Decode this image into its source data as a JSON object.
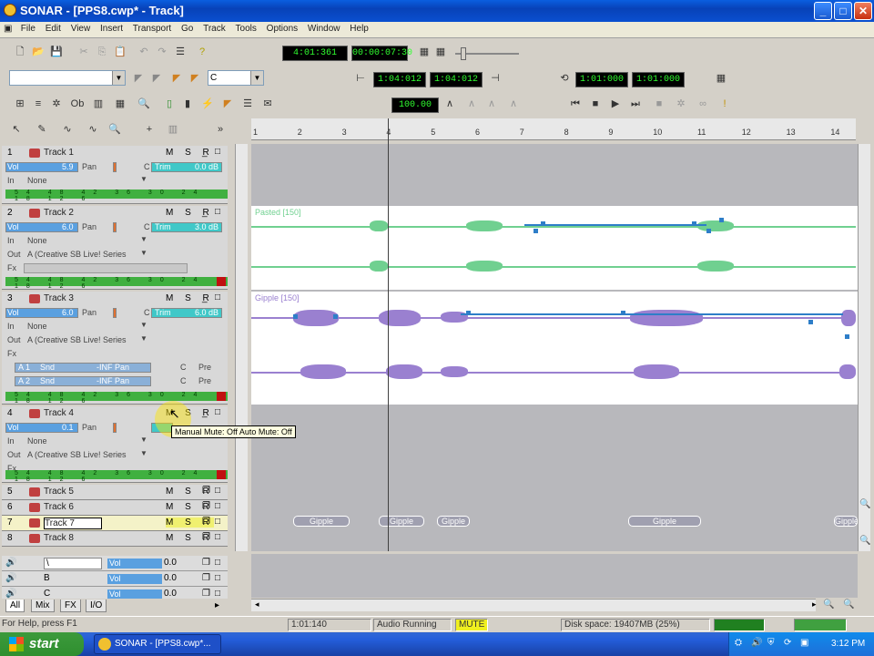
{
  "window": {
    "title": "SONAR - [PPS8.cwp* - Track]"
  },
  "menu": [
    "File",
    "Edit",
    "View",
    "Insert",
    "Transport",
    "Go",
    "Track",
    "Tools",
    "Options",
    "Window",
    "Help"
  ],
  "transport": {
    "now_time": "4:01:361",
    "smpte": "00:00:07:30",
    "loop_start": "1:04:012",
    "loop_end": "1:04:012",
    "punch_start": "1:01:000",
    "punch_end": "1:01:000",
    "tempo": "100.00",
    "key_combo": "C"
  },
  "ruler_ticks": [
    "1",
    "2",
    "3",
    "4",
    "5",
    "6",
    "7",
    "8",
    "9",
    "10",
    "11",
    "12",
    "13",
    "14"
  ],
  "tracks": [
    {
      "num": "1",
      "name": "Track 1",
      "vol_label": "Vol",
      "vol": "5.9",
      "pan_label": "Pan",
      "pan": "C",
      "trim_label": "Trim",
      "trim": "0.0 dB",
      "in_label": "In",
      "input": "None",
      "meter": "54 48 42 36 30 24 18 12 6"
    },
    {
      "num": "2",
      "name": "Track 2",
      "vol_label": "Vol",
      "vol": "6.0",
      "pan_label": "Pan",
      "pan": "C",
      "trim_label": "Trim",
      "trim": "3.0 dB",
      "in_label": "In",
      "input": "None",
      "out_label": "Out",
      "output": "A (Creative SB Live! Series",
      "fx_label": "Fx",
      "meter": "54 48 42 36 30 24 18 12 6"
    },
    {
      "num": "3",
      "name": "Track 3",
      "vol_label": "Vol",
      "vol": "6.0",
      "pan_label": "Pan",
      "pan": "C",
      "trim_label": "Trim",
      "trim": "6.0 dB",
      "in_label": "In",
      "input": "None",
      "out_label": "Out",
      "output": "A (Creative SB Live! Series",
      "fx_label": "Fx",
      "send1_label": "A 1",
      "send1": "Snd",
      "send1_val": "-INF",
      "send1_pan": "Pan",
      "send1_c": "C",
      "send1_pre": "Pre",
      "send2_label": "A 2",
      "send2": "Snd",
      "send2_val": "-INF",
      "send2_pan": "Pan",
      "send2_c": "C",
      "send2_pre": "Pre",
      "meter": "54 48 42 36 30 24 18 12 6"
    },
    {
      "num": "4",
      "name": "Track 4",
      "vol_label": "Vol",
      "vol": "0.1",
      "pan_label": "Pan",
      "pan": "",
      "trim_label": "",
      "trim": "",
      "in_label": "In",
      "input": "None",
      "out_label": "Out",
      "output": "A (Creative SB Live! Series",
      "fx_label": "Fx",
      "meter": "54 48 42 36 30 24 18 12 6"
    },
    {
      "num": "5",
      "name": "Track 5"
    },
    {
      "num": "6",
      "name": "Track 6"
    },
    {
      "num": "7",
      "name": "Track 7"
    },
    {
      "num": "8",
      "name": "Track 8"
    }
  ],
  "track_buttons": "M S R",
  "tooltip": "Manual Mute: Off Auto Mute: Off",
  "clips": {
    "lane1": "Pasted [150]",
    "lane2": "Gipple [150]",
    "small": "Gipple"
  },
  "buses": [
    {
      "name": "\\",
      "vol_label": "Vol",
      "vol": "0.0"
    },
    {
      "name": "B",
      "vol_label": "Vol",
      "vol": "0.0"
    },
    {
      "name": "C",
      "vol_label": "Vol",
      "vol": "0.0"
    }
  ],
  "tabs": [
    "All",
    "Mix",
    "FX",
    "I/O"
  ],
  "status": {
    "help": "For Help, press F1",
    "time": "1:01:140",
    "audio": "Audio Running",
    "mute": "MUTE",
    "disk": "Disk space: 19407MB (25%)"
  },
  "taskbar": {
    "start": "start",
    "task": "SONAR - [PPS8.cwp*...",
    "clock": "3:12 PM"
  },
  "colors": {
    "vol_bar": "#5aa0e0",
    "trim_bar": "#40c8c8",
    "meter": "#40b040",
    "wave_green": "#70d090",
    "wave_purple": "#9a80d0",
    "tooltip_bg": "#ffffe1"
  }
}
